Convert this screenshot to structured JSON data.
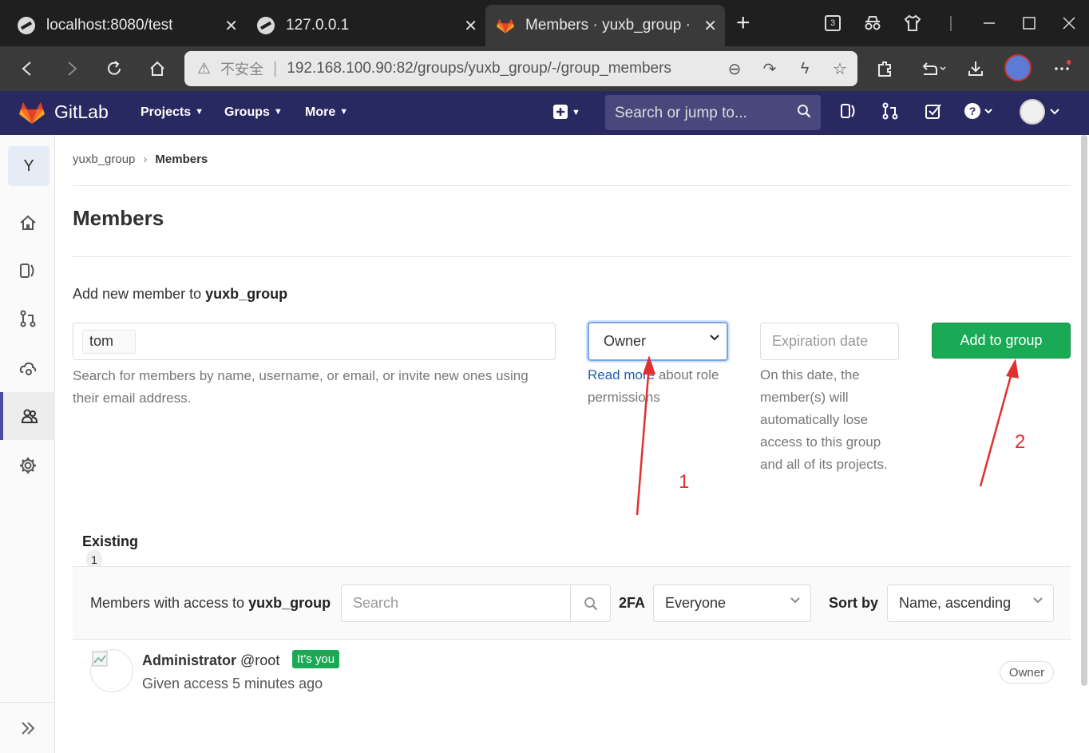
{
  "browser": {
    "tabs": [
      {
        "title": "localhost:8080/test",
        "close": "✕"
      },
      {
        "title": "127.0.0.1",
        "close": "✕"
      },
      {
        "title": "Members · yuxb_group ·",
        "close": "✕"
      }
    ],
    "new_tab": "+",
    "tab_count": "3",
    "insecure_label": "不安全",
    "url": "192.168.100.90:82/groups/yuxb_group/-/group_members"
  },
  "gitlab": {
    "brand": "GitLab",
    "nav": [
      {
        "label": "Projects"
      },
      {
        "label": "Groups"
      },
      {
        "label": "More"
      }
    ],
    "search_placeholder": "Search or jump to..."
  },
  "sidebar": {
    "group_letter": "Y"
  },
  "breadcrumb": {
    "group": "yuxb_group",
    "separator": "›",
    "current": "Members"
  },
  "page": {
    "title": "Members",
    "add_prefix": "Add new member to ",
    "group_name": "yuxb_group",
    "user_token": "tom",
    "user_help": "Search for members by name, username, or email, or invite new ones using their email address.",
    "role_value": "Owner",
    "read_more": "Read more",
    "role_help_suffix": " about role permissions",
    "expiration_placeholder": "Expiration date",
    "expiration_help": "On this date, the member(s) will automatically lose access to this group and all of its projects.",
    "add_button": "Add to group",
    "annotation_1": "1",
    "annotation_2": "2"
  },
  "existing": {
    "tab_label": "Existing",
    "count": "1",
    "filter_prefix": "Members with access to ",
    "group_name": "yuxb_group",
    "search_placeholder": "Search",
    "twofa_label": "2FA",
    "twofa_value": "Everyone",
    "sort_label": "Sort by",
    "sort_value": "Name, ascending",
    "members": [
      {
        "name": "Administrator",
        "username": "@root",
        "badge": "It's you",
        "access": "Given access 5 minutes ago",
        "role": "Owner"
      }
    ]
  }
}
